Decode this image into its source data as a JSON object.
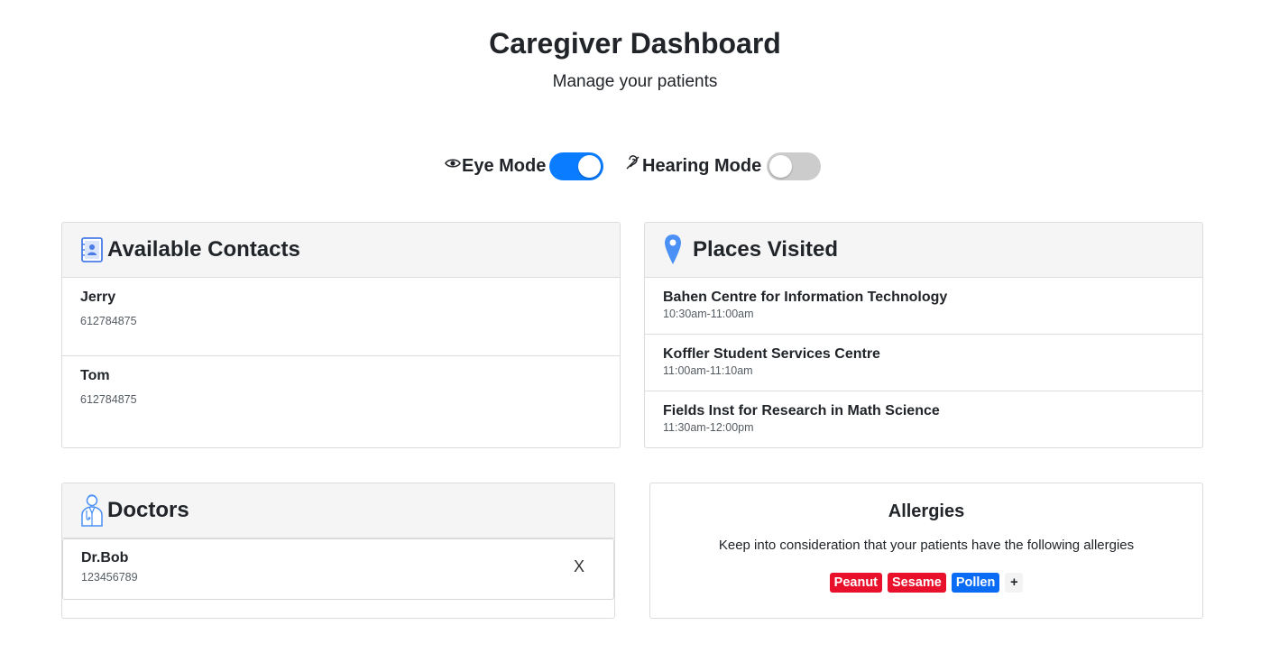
{
  "header": {
    "title": "Caregiver Dashboard",
    "subtitle": "Manage your patients"
  },
  "modes": {
    "eye": {
      "label": "Eye Mode",
      "icon": "eye-icon",
      "enabled": true
    },
    "hearing": {
      "label": "Hearing Mode",
      "icon": "hearing-icon",
      "enabled": false
    }
  },
  "contacts": {
    "title": "Available Contacts",
    "icon": "contact-book-icon",
    "items": [
      {
        "name": "Jerry",
        "phone": "612784875"
      },
      {
        "name": "Tom",
        "phone": "612784875"
      }
    ]
  },
  "places": {
    "title": "Places Visited",
    "icon": "map-pin-icon",
    "items": [
      {
        "name": "Bahen Centre for Information Technology",
        "time": "10:30am-11:00am"
      },
      {
        "name": "Koffler Student Services Centre",
        "time": "11:00am-11:10am"
      },
      {
        "name": "Fields Inst for Research in Math Science",
        "time": "11:30am-12:00pm"
      }
    ]
  },
  "doctors": {
    "title": "Doctors",
    "icon": "doctor-icon",
    "items": [
      {
        "name": "Dr.Bob",
        "phone": "123456789",
        "remove_label": "X"
      }
    ]
  },
  "allergies": {
    "title": "Allergies",
    "description": "Keep into consideration that your patients have the following allergies",
    "items": [
      {
        "label": "Peanut",
        "color": "#e8102a"
      },
      {
        "label": "Sesame",
        "color": "#e8102a"
      },
      {
        "label": "Pollen",
        "color": "#0a6cf5"
      }
    ],
    "add_label": "+"
  },
  "colors": {
    "toggle_on": "#0a7cff",
    "toggle_off": "#cccccc",
    "accent_icon": "#4a90f5"
  }
}
